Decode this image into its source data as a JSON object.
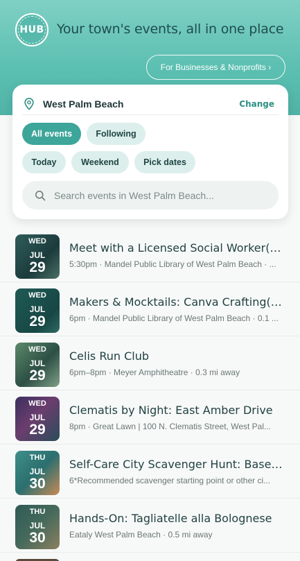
{
  "header": {
    "logo_text": "HUB",
    "tagline": "Your town's events, all in one place",
    "business_button": "For Businesses & Nonprofits ›"
  },
  "location": {
    "name": "West Palm Beach",
    "change_label": "Change"
  },
  "filters": {
    "all_events": "All events",
    "following": "Following",
    "today": "Today",
    "weekend": "Weekend",
    "pick_dates": "Pick dates"
  },
  "search": {
    "placeholder": "Search events in West Palm Beach..."
  },
  "events": [
    {
      "dow": "WED",
      "month": "JUL",
      "day": "29",
      "title": "Meet with a Licensed Social Worker(Op...",
      "meta": "5:30pm · Mandel Public Library of West Palm Beach · ..."
    },
    {
      "dow": "WED",
      "month": "JUL",
      "day": "29",
      "title": "Makers & Mocktails: Canva Crafting(Op...",
      "meta": "6pm · Mandel Public Library of West Palm Beach · 0.1 ..."
    },
    {
      "dow": "WED",
      "month": "JUL",
      "day": "29",
      "title": "Celis Run Club",
      "meta": "6pm–8pm · Meyer Amphitheatre · 0.3 mi away"
    },
    {
      "dow": "WED",
      "month": "JUL",
      "day": "29",
      "title": "Clematis by Night: East Amber Drive",
      "meta": "8pm · Great Lawn | 100 N. Clematis Street, West Pal..."
    },
    {
      "dow": "THU",
      "month": "JUL",
      "day": "30",
      "title": "Self-Care City Scavenger Hunt: Based ...",
      "meta": "6*Recommended scavenger starting point or other ci..."
    },
    {
      "dow": "THU",
      "month": "JUL",
      "day": "30",
      "title": "Hands-On: Tagliatelle alla Bolognese",
      "meta": "Eataly West Palm Beach · 0.5 mi away"
    }
  ],
  "colors": {
    "accent": "#3da59a",
    "header": "#5bbfb1",
    "chip": "#dcefec"
  }
}
